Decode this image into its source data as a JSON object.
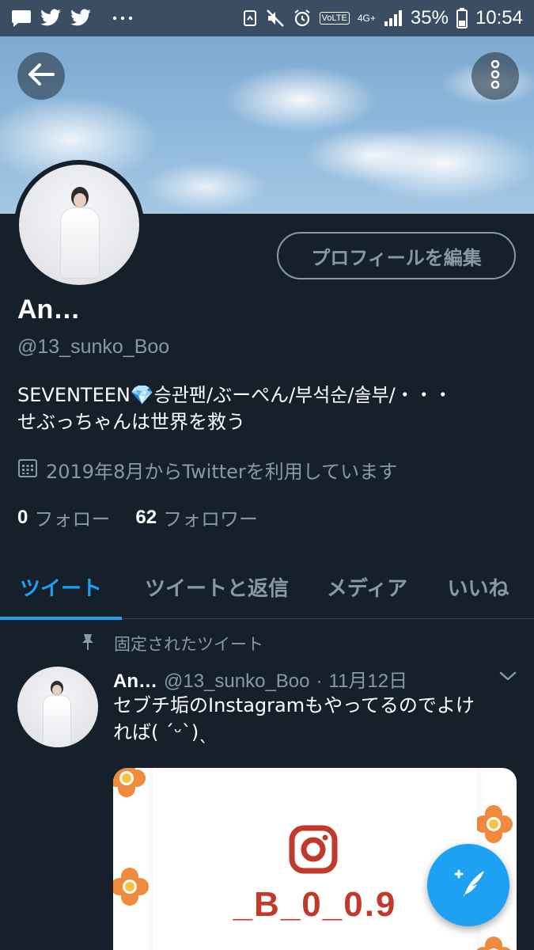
{
  "status_bar": {
    "battery": "35%",
    "time": "10:54",
    "volte": "VoLTE",
    "network": "4G+",
    "left_icons": [
      "message-icon",
      "twitter-icon",
      "twitter-icon",
      "more-dots-icon"
    ],
    "right_icons": [
      "recycle-icon",
      "mute-icon",
      "alarm-icon",
      "signal-icon",
      "battery-icon"
    ]
  },
  "header": {
    "back_icon": "arrow-left-icon",
    "more_icon": "vertical-dots-icon"
  },
  "profile": {
    "edit_button": "プロフィールを編集",
    "name": "An…",
    "handle": "@13_sunko_Boo",
    "bio_line1": "SEVENTEEN💎승관팬/ぶーぺん/부석순/솔부/・・・",
    "bio_line2": "せぶっちゃんは世界を救う",
    "joined": "2019年8月からTwitterを利用しています",
    "following_count": "0",
    "following_label": "フォロー",
    "followers_count": "62",
    "followers_label": "フォロワー"
  },
  "tabs": [
    {
      "label": "ツイート",
      "active": true
    },
    {
      "label": "ツイートと返信",
      "active": false
    },
    {
      "label": "メディア",
      "active": false
    },
    {
      "label": "いいね",
      "active": false
    }
  ],
  "tweet": {
    "pinned_label": "固定されたツイート",
    "name": "An…",
    "handle": "@13_sunko_Boo",
    "dot": "·",
    "date": "11月12日",
    "text_line1": "セブチ垢のInstagramもやってるのでよけ",
    "text_line2": "れば( ˊᵕˋ)ˎ",
    "media_text": "_B_0_0.9"
  },
  "colors": {
    "background": "#15202b",
    "accent": "#1da1f2",
    "secondary_text": "#8899a6",
    "divider": "#38444d"
  }
}
